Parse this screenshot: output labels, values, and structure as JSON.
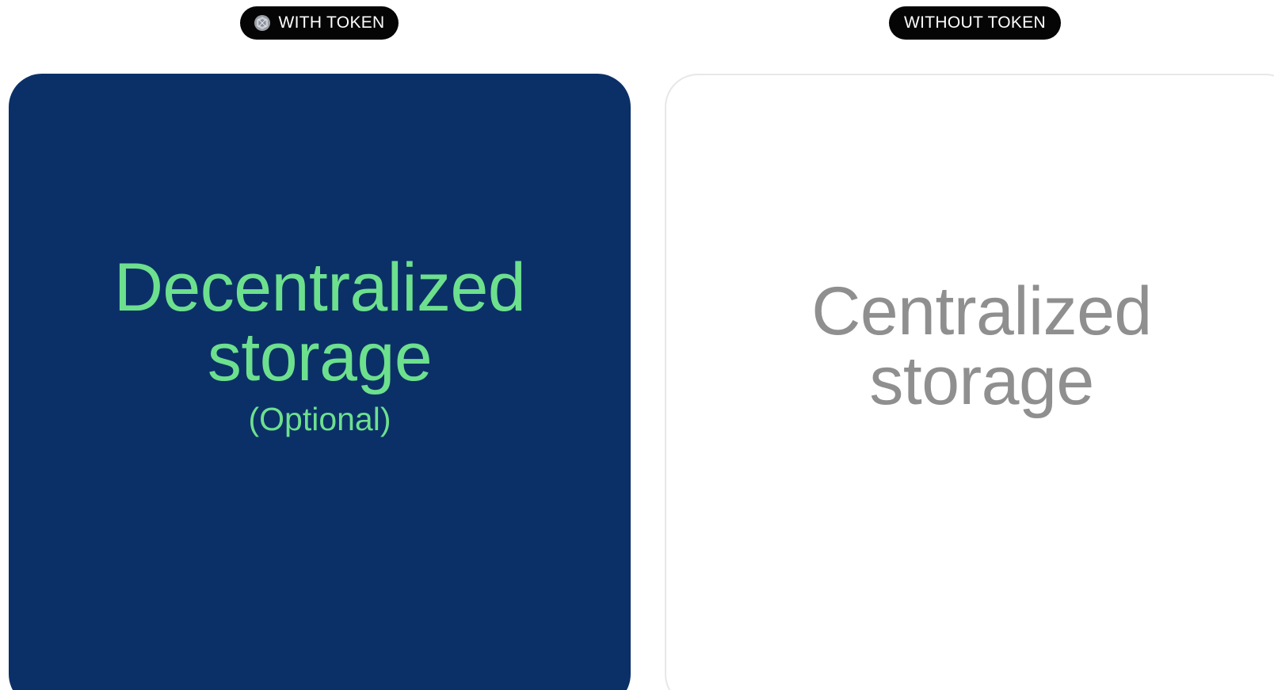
{
  "badges": {
    "with_token": {
      "label": "WITH TOKEN",
      "icon": "token-coin-icon"
    },
    "without_token": {
      "label": "WITHOUT TOKEN"
    }
  },
  "cards": {
    "with_token": {
      "title_line1": "Decentralized",
      "title_line2": "storage",
      "subtitle": "(Optional)",
      "background_color": "#0b3067",
      "text_color": "#6de08e"
    },
    "without_token": {
      "title_line1": "Centralized",
      "title_line2": "storage",
      "background_color": "#ffffff",
      "text_color": "#8f8f8f"
    }
  }
}
